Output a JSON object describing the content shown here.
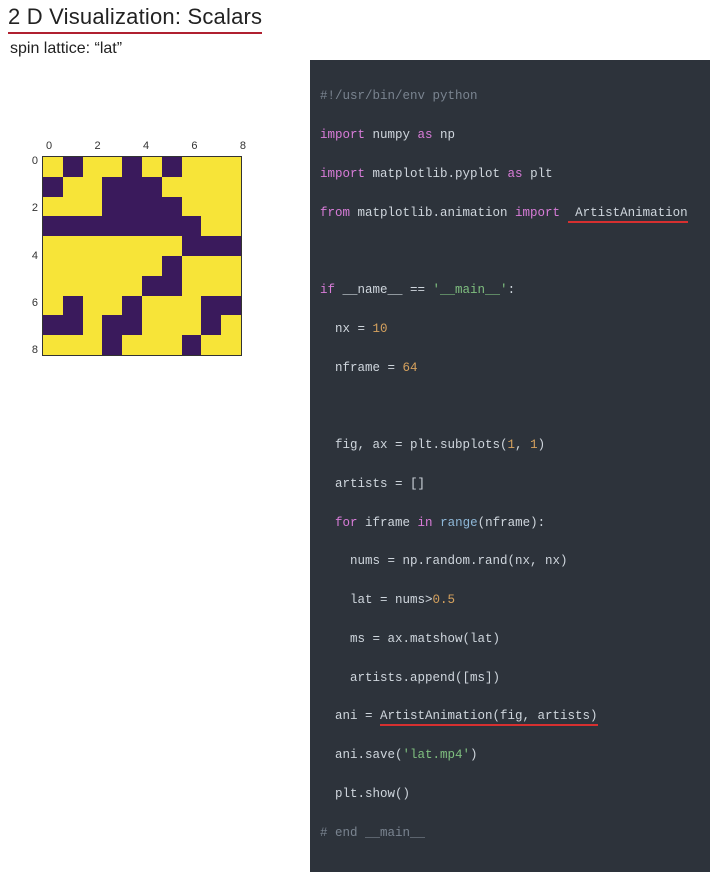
{
  "title": "2 D Visualization: Scalars",
  "subtitle": "spin lattice: “lat”",
  "plot": {
    "ticks_x": [
      "0",
      "2",
      "4",
      "6",
      "8"
    ],
    "ticks_y": [
      "0",
      "2",
      "4",
      "6",
      "8"
    ],
    "lattice": [
      [
        1,
        0,
        1,
        1,
        0,
        1,
        0,
        1,
        1,
        1
      ],
      [
        0,
        1,
        1,
        0,
        0,
        0,
        1,
        1,
        1,
        1
      ],
      [
        1,
        1,
        1,
        0,
        0,
        0,
        0,
        1,
        1,
        1
      ],
      [
        0,
        0,
        0,
        0,
        0,
        0,
        0,
        0,
        1,
        1
      ],
      [
        1,
        1,
        1,
        1,
        1,
        1,
        1,
        0,
        0,
        0
      ],
      [
        1,
        1,
        1,
        1,
        1,
        1,
        0,
        1,
        1,
        1
      ],
      [
        1,
        1,
        1,
        1,
        1,
        0,
        0,
        1,
        1,
        1
      ],
      [
        1,
        0,
        1,
        1,
        0,
        1,
        1,
        1,
        0,
        0
      ],
      [
        0,
        0,
        1,
        0,
        0,
        1,
        1,
        1,
        0,
        1
      ],
      [
        1,
        1,
        1,
        0,
        1,
        1,
        1,
        0,
        1,
        1
      ]
    ]
  },
  "code": {
    "l01a": "#!/usr/bin/env python",
    "l02a": "import",
    "l02b": " numpy ",
    "l02c": "as",
    "l02d": " np",
    "l03a": "import",
    "l03b": " matplotlib.pyplot ",
    "l03c": "as",
    "l03d": " plt",
    "l04a": "from",
    "l04b": " matplotlib.animation ",
    "l04c": "import",
    "l04d": " ArtistAnimation",
    "l06a": "if",
    "l06b": " __name__ == ",
    "l06c": "'__main__'",
    "l06d": ":",
    "l07a": "  nx = ",
    "l07b": "10",
    "l08a": "  nframe = ",
    "l08b": "64",
    "l10a": "  fig, ax = plt.subplots(",
    "l10b": "1",
    "l10c": ", ",
    "l10d": "1",
    "l10e": ")",
    "l11a": "  artists = []",
    "l12a": "  ",
    "l12b": "for",
    "l12c": " iframe ",
    "l12d": "in",
    "l12e": " ",
    "l12f": "range",
    "l12g": "(nframe):",
    "l13a": "    nums = np.random.rand(nx, nx)",
    "l14a": "    lat = nums>",
    "l14b": "0.5",
    "l15a": "    ms = ax.matshow(lat)",
    "l16a": "    artists.append([ms])",
    "l17a": "  ani = ",
    "l17b": "ArtistAnimation(fig, artists)",
    "l18a": "  ani.save(",
    "l18b": "'lat.mp4'",
    "l18c": ")",
    "l19a": "  plt.show()",
    "l20a": "# end __main__"
  }
}
